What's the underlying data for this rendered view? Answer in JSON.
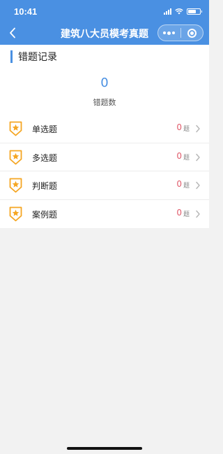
{
  "status_bar": {
    "time": "10:41"
  },
  "nav": {
    "title": "建筑八大员模考真题",
    "back_icon": "chevron-left-icon",
    "more_icon": "more-dots-icon",
    "close_icon": "target-icon"
  },
  "section": {
    "title": "错题记录"
  },
  "summary": {
    "count": "0",
    "label": "错题数"
  },
  "items": [
    {
      "label": "单选题",
      "count": "0",
      "unit": "题",
      "icon": "star-badge-icon"
    },
    {
      "label": "多选题",
      "count": "0",
      "unit": "题",
      "icon": "star-badge-icon"
    },
    {
      "label": "判断题",
      "count": "0",
      "unit": "题",
      "icon": "star-badge-icon"
    },
    {
      "label": "案例题",
      "count": "0",
      "unit": "题",
      "icon": "star-badge-icon"
    }
  ],
  "colors": {
    "primary": "#4a90e2",
    "accent_orange": "#f5a623",
    "count_red": "#e05a6a",
    "background": "#f2f2f2"
  }
}
